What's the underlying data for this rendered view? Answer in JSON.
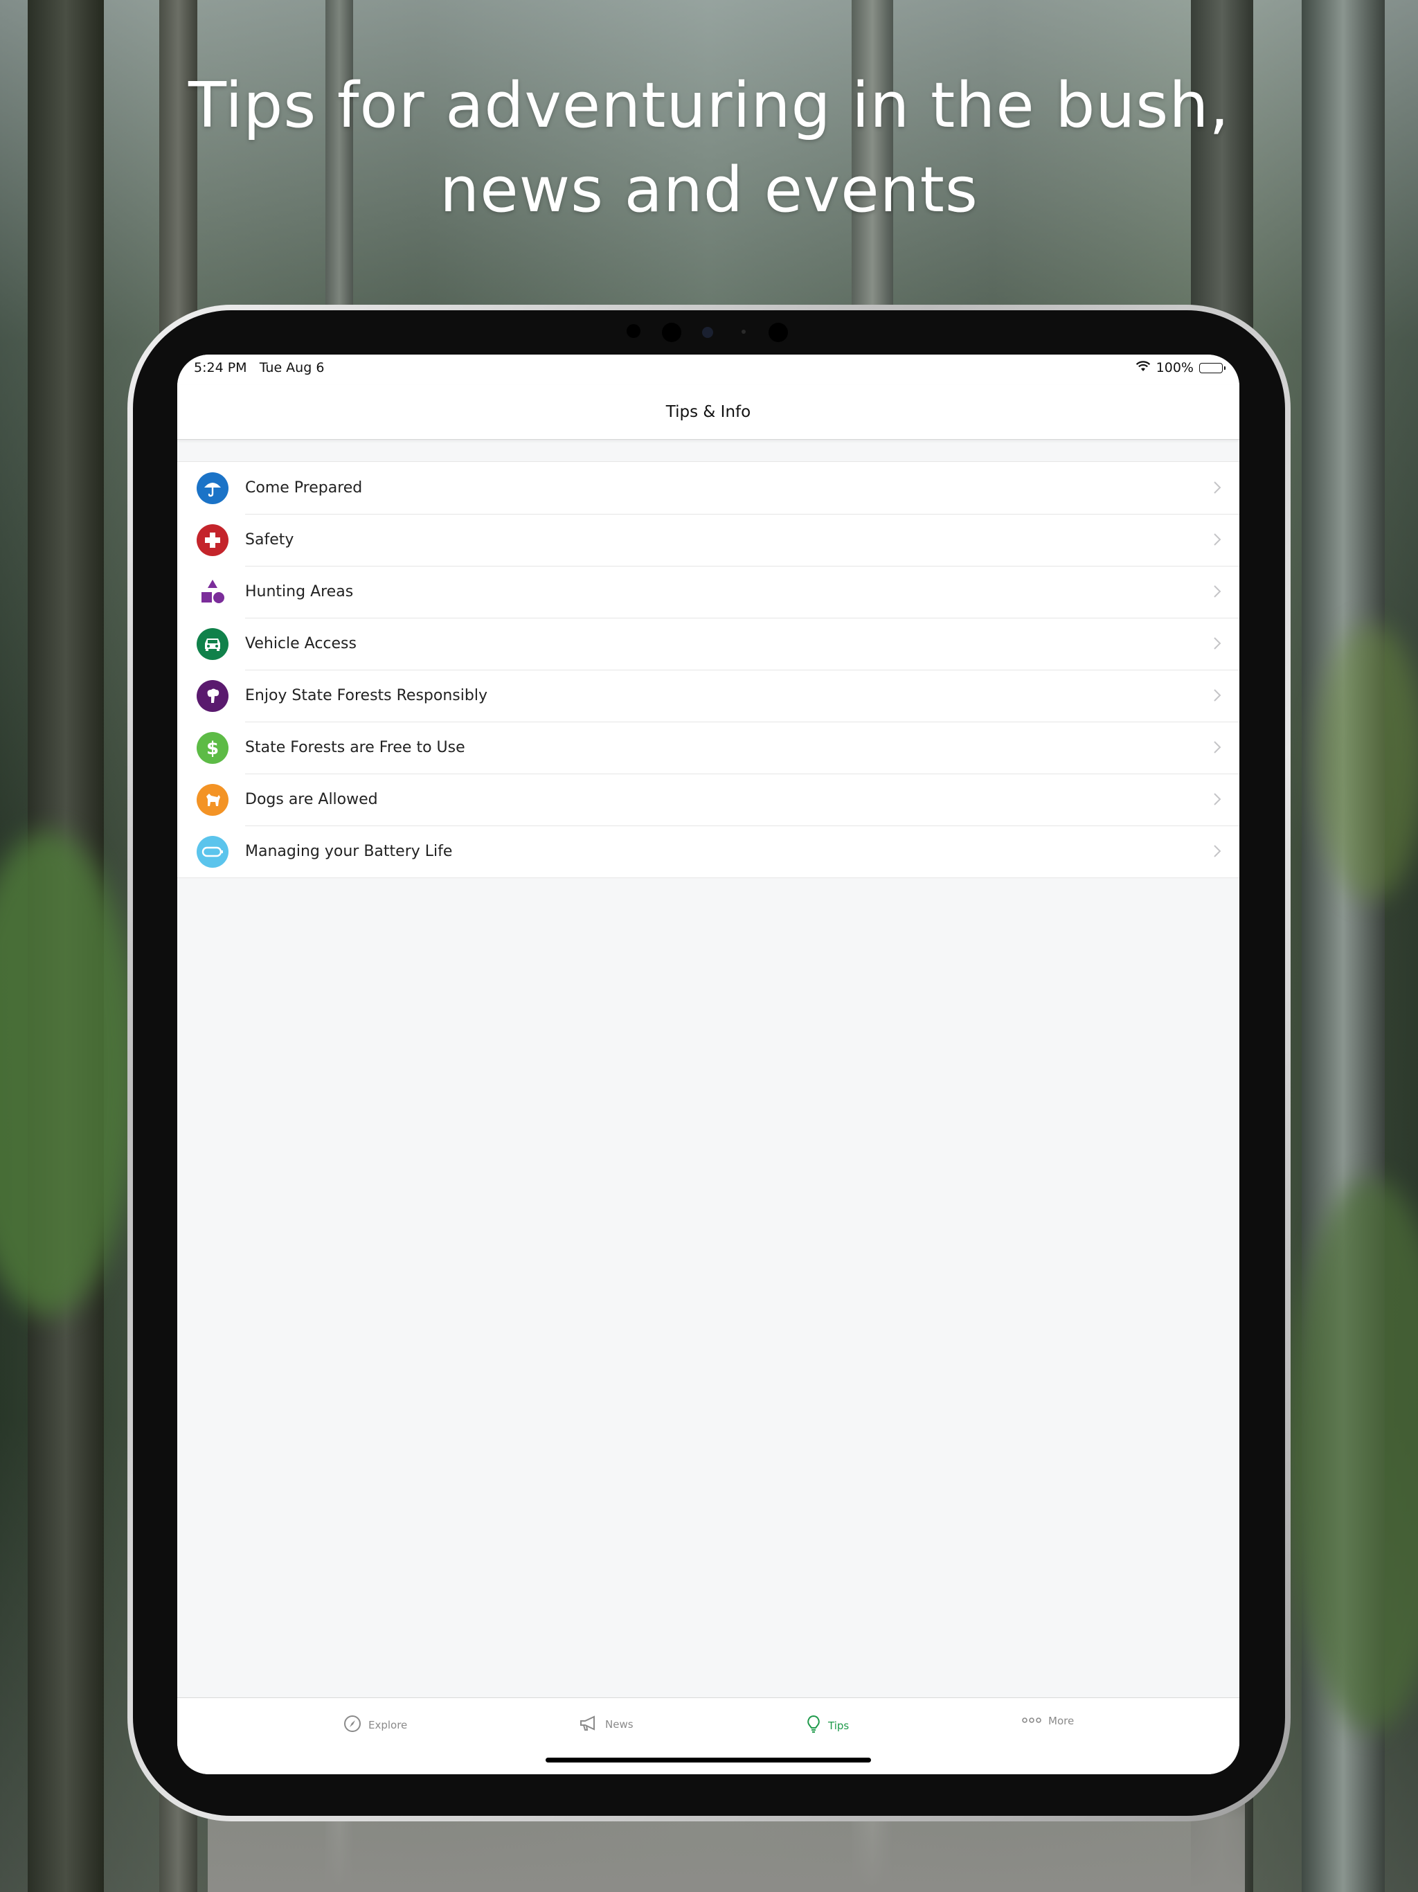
{
  "headline": {
    "line1": "Tips for adventuring in the bush,",
    "line2": "news and events"
  },
  "status_bar": {
    "time": "5:24 PM",
    "date": "Tue Aug 6",
    "battery": "100%",
    "battery_level": 1.0
  },
  "nav": {
    "title": "Tips & Info"
  },
  "tips": [
    {
      "label": "Come Prepared",
      "icon": "umbrella-icon",
      "color": "#1b73c7"
    },
    {
      "label": "Safety",
      "icon": "first-aid-cross-icon",
      "color": "#c4242b"
    },
    {
      "label": "Hunting Areas",
      "icon": "shapes-icon",
      "color": "#7b2d9a"
    },
    {
      "label": "Vehicle Access",
      "icon": "car-icon",
      "color": "#10814a"
    },
    {
      "label": "Enjoy State Forests Responsibly",
      "icon": "forest-care-icon",
      "color": "#5a1a6e"
    },
    {
      "label": "State Forests are Free to Use",
      "icon": "dollar-icon",
      "color": "#5dbb46"
    },
    {
      "label": "Dogs are Allowed",
      "icon": "dog-icon",
      "color": "#f39325"
    },
    {
      "label": "Managing your Battery Life",
      "icon": "battery-icon",
      "color": "#5bc4ec"
    }
  ],
  "tabbar": {
    "tabs": [
      {
        "label": "Explore",
        "icon": "compass-icon",
        "active": false
      },
      {
        "label": "News",
        "icon": "megaphone-icon",
        "active": false
      },
      {
        "label": "Tips",
        "icon": "lightbulb-icon",
        "active": true
      },
      {
        "label": "More",
        "icon": "more-dots-icon",
        "active": false
      }
    ],
    "active_color": "#1f9a4b"
  }
}
